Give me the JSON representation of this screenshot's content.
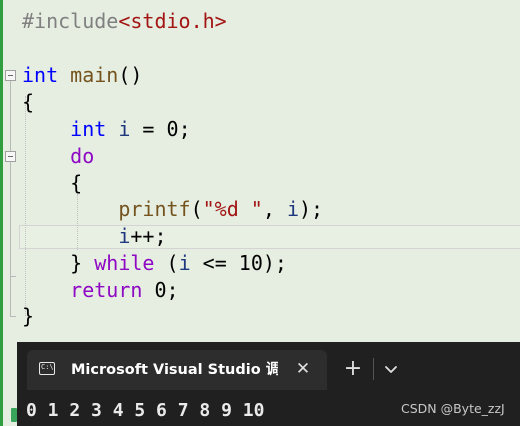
{
  "editor": {
    "lines": [
      {
        "tokens": [
          {
            "text": "#include",
            "cls": "t-pre"
          },
          {
            "text": "<stdio.h>",
            "cls": "t-inc"
          }
        ]
      },
      {
        "tokens": []
      },
      {
        "tokens": [
          {
            "text": "int",
            "cls": "t-kw"
          },
          {
            "text": " ",
            "cls": "t-op"
          },
          {
            "text": "main",
            "cls": "t-fn"
          },
          {
            "text": "()",
            "cls": "t-op"
          }
        ]
      },
      {
        "tokens": [
          {
            "text": "{",
            "cls": "t-op"
          }
        ]
      },
      {
        "tokens": [
          {
            "text": "    ",
            "cls": "t-op"
          },
          {
            "text": "int",
            "cls": "t-kw"
          },
          {
            "text": " ",
            "cls": "t-op"
          },
          {
            "text": "i",
            "cls": "t-var"
          },
          {
            "text": " = ",
            "cls": "t-op"
          },
          {
            "text": "0",
            "cls": "t-op"
          },
          {
            "text": ";",
            "cls": "t-op"
          }
        ]
      },
      {
        "tokens": [
          {
            "text": "    ",
            "cls": "t-op"
          },
          {
            "text": "do",
            "cls": "t-ctl"
          }
        ]
      },
      {
        "tokens": [
          {
            "text": "    {",
            "cls": "t-op"
          }
        ]
      },
      {
        "tokens": [
          {
            "text": "        ",
            "cls": "t-op"
          },
          {
            "text": "printf",
            "cls": "t-fn"
          },
          {
            "text": "(",
            "cls": "t-op"
          },
          {
            "text": "\"%d \"",
            "cls": "t-str"
          },
          {
            "text": ", ",
            "cls": "t-op"
          },
          {
            "text": "i",
            "cls": "t-var"
          },
          {
            "text": ");",
            "cls": "t-op"
          }
        ]
      },
      {
        "tokens": [
          {
            "text": "        ",
            "cls": "t-op"
          },
          {
            "text": "i",
            "cls": "t-var"
          },
          {
            "text": "++;",
            "cls": "t-op"
          }
        ]
      },
      {
        "tokens": [
          {
            "text": "    } ",
            "cls": "t-op"
          },
          {
            "text": "while",
            "cls": "t-ctl"
          },
          {
            "text": " (",
            "cls": "t-op"
          },
          {
            "text": "i",
            "cls": "t-var"
          },
          {
            "text": " <= ",
            "cls": "t-op"
          },
          {
            "text": "10",
            "cls": "t-op"
          },
          {
            "text": ");",
            "cls": "t-op"
          }
        ]
      },
      {
        "tokens": [
          {
            "text": "    ",
            "cls": "t-op"
          },
          {
            "text": "return",
            "cls": "t-ctl"
          },
          {
            "text": " ",
            "cls": "t-op"
          },
          {
            "text": "0",
            "cls": "t-op"
          },
          {
            "text": ";",
            "cls": "t-op"
          }
        ]
      },
      {
        "tokens": [
          {
            "text": "}",
            "cls": "t-op"
          }
        ]
      }
    ]
  },
  "terminal": {
    "tab_icon_glyph": "C:\\",
    "tab_title": "Microsoft Visual Studio 调试控制台",
    "close_glyph": "✕",
    "new_tab_glyph": "+",
    "output": "0 1 2 3 4 5 6 7 8 9 10"
  },
  "watermark": "CSDN @Byte_zzJ",
  "colors": {
    "editor_bg": "#e5eee0",
    "terminal_bg": "#202020",
    "tab_bg": "#2d2d2d",
    "keyword": "#0000ff",
    "control_keyword": "#8f08c4",
    "function": "#74531f",
    "variable": "#1f377f",
    "string": "#a31515",
    "preprocessor": "#808080",
    "gutter_bar": "#2f9e3e"
  },
  "icons": {
    "tab_icon": "console-icon",
    "close": "close-icon",
    "new_tab": "plus-icon",
    "dropdown": "chevron-down-icon",
    "fold": "collapse-icon"
  }
}
